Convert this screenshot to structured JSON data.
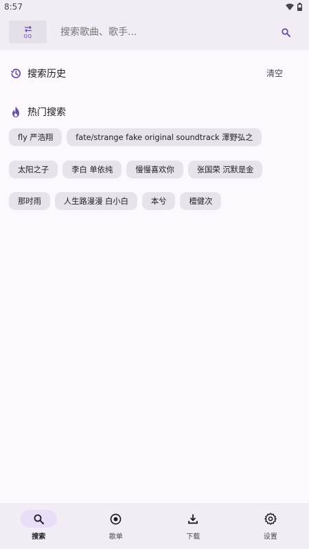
{
  "status_bar": {
    "time": "8:57",
    "icons": [
      "wifi-icon",
      "battery-icon"
    ]
  },
  "top_bar": {
    "source_label": "QQ",
    "search_placeholder": "搜索歌曲、歌手...",
    "accent_color": "#6750a4"
  },
  "history": {
    "title": "搜索历史",
    "clear_label": "清空",
    "icon": "history-icon"
  },
  "hot": {
    "title": "热门搜索",
    "icon": "flame-icon",
    "items": [
      "fly 严浩翔",
      "fate/strange fake original soundtrack 澤野弘之",
      "太阳之子",
      "李白 单依纯",
      "慢慢喜欢你",
      "张国荣 沉默是金",
      "那时雨",
      "人生路漫漫 白小白",
      "本兮",
      "檀健次"
    ]
  },
  "bottom_nav": {
    "items": [
      {
        "label": "搜索",
        "icon": "search-icon",
        "active": true
      },
      {
        "label": "歌单",
        "icon": "disc-icon",
        "active": false
      },
      {
        "label": "下载",
        "icon": "download-icon",
        "active": false
      },
      {
        "label": "设置",
        "icon": "gear-icon",
        "active": false
      }
    ]
  }
}
